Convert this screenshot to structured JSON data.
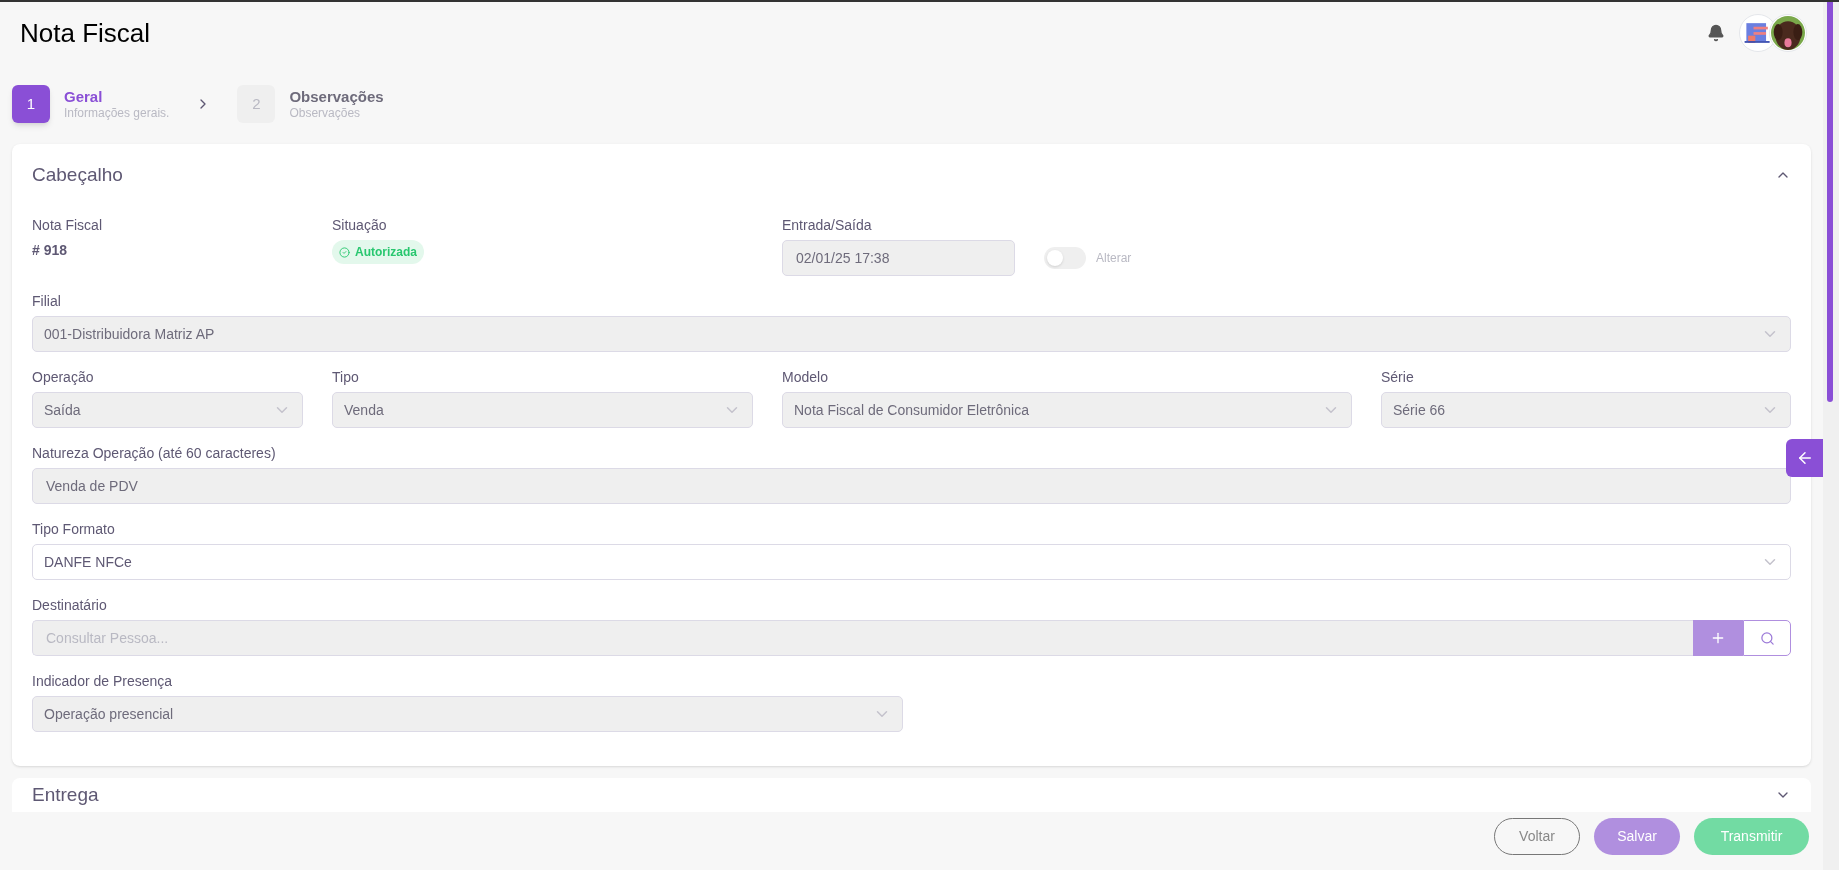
{
  "page": {
    "title": "Nota Fiscal"
  },
  "steps": [
    {
      "number": "1",
      "title": "Geral",
      "subtitle": "Informações gerais.",
      "selected": true
    },
    {
      "number": "2",
      "title": "Observações",
      "subtitle": "Observações",
      "selected": false
    }
  ],
  "section": {
    "title": "Cabeçalho",
    "expanded": true,
    "invoice": {
      "label": "Nota Fiscal",
      "value": "# 918"
    },
    "status": {
      "label": "Situação",
      "badge": "Autorizada"
    },
    "entry": {
      "label": "Entrada/Saída",
      "value": "02/01/25 17:38",
      "toggle_label": "Alterar",
      "on": false
    },
    "rows": [
      [
        {
          "label": "Filial",
          "value": "001-Distribuidora Matriz AP",
          "kind": "select",
          "disabled": true
        }
      ],
      [
        {
          "label": "Operação",
          "value": "Saída",
          "kind": "select",
          "disabled": true
        },
        {
          "label": "Tipo",
          "value": "Venda",
          "kind": "select",
          "disabled": true
        },
        {
          "label": "Modelo",
          "value": "Nota Fiscal de Consumidor Eletrônica",
          "kind": "select",
          "disabled": true
        },
        {
          "label": "Série",
          "value": "Série 66",
          "kind": "select",
          "disabled": true
        }
      ],
      [
        {
          "label": "Natureza Operação (até 60 caracteres)",
          "value": "Venda de PDV",
          "kind": "input",
          "disabled": true
        }
      ],
      [
        {
          "label": "Tipo Formato",
          "value": "DANFE NFCe",
          "kind": "select",
          "disabled": false
        }
      ],
      [
        {
          "label": "Destinatário",
          "placeholder": "Consultar Pessoa...",
          "kind": "lookup",
          "disabled": true
        }
      ],
      [
        {
          "label": "Indicador de Presença",
          "value": "Operação presencial",
          "kind": "select",
          "disabled": true
        }
      ]
    ]
  },
  "next_section": {
    "title": "Entrega",
    "expanded": false
  },
  "buttons": [
    {
      "label": "Voltar",
      "kind": "outline"
    },
    {
      "label": "Salvar",
      "kind": "primary"
    },
    {
      "label": "Transmitir",
      "kind": "success"
    }
  ]
}
